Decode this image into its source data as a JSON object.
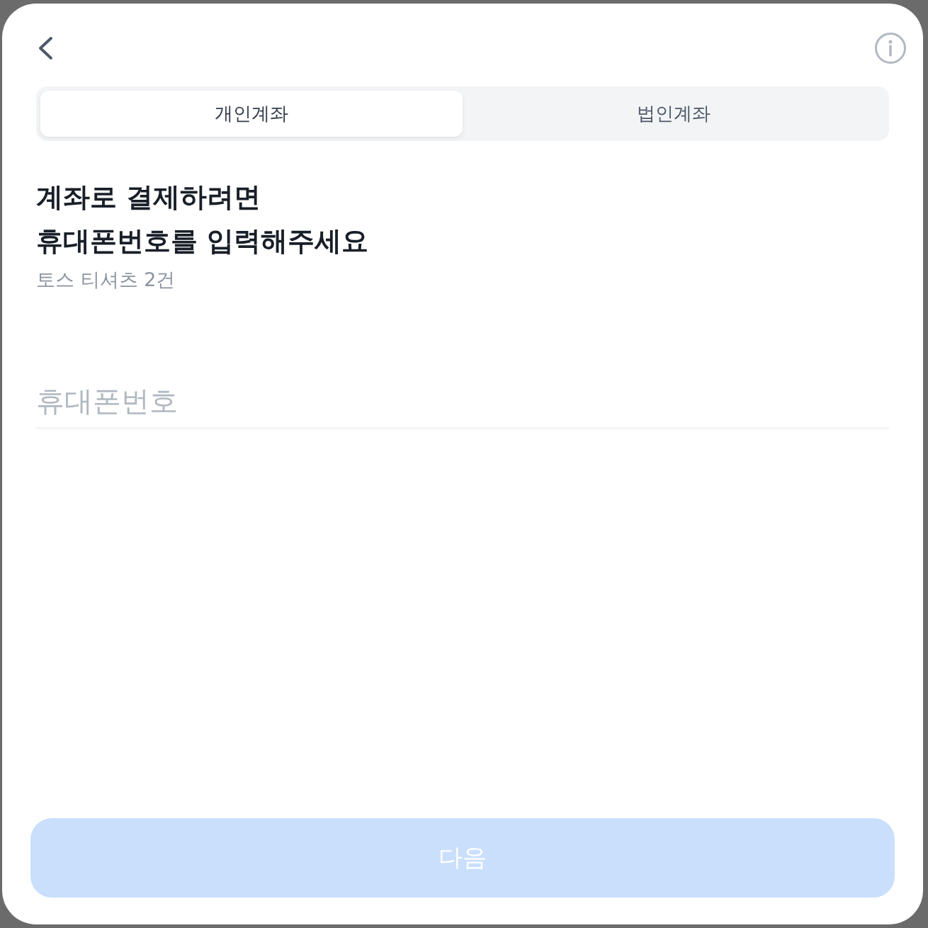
{
  "tabs": [
    {
      "label": "개인계좌",
      "selected": true
    },
    {
      "label": "법인계좌",
      "selected": false
    }
  ],
  "heading": [
    "계좌로 결제하려면",
    "휴대폰번호를 입력해주세요"
  ],
  "subtitle": "토스 티셔츠 2건",
  "phone_field": {
    "placeholder": "휴대폰번호"
  },
  "next_button": {
    "label": "다음",
    "disabled": true
  }
}
